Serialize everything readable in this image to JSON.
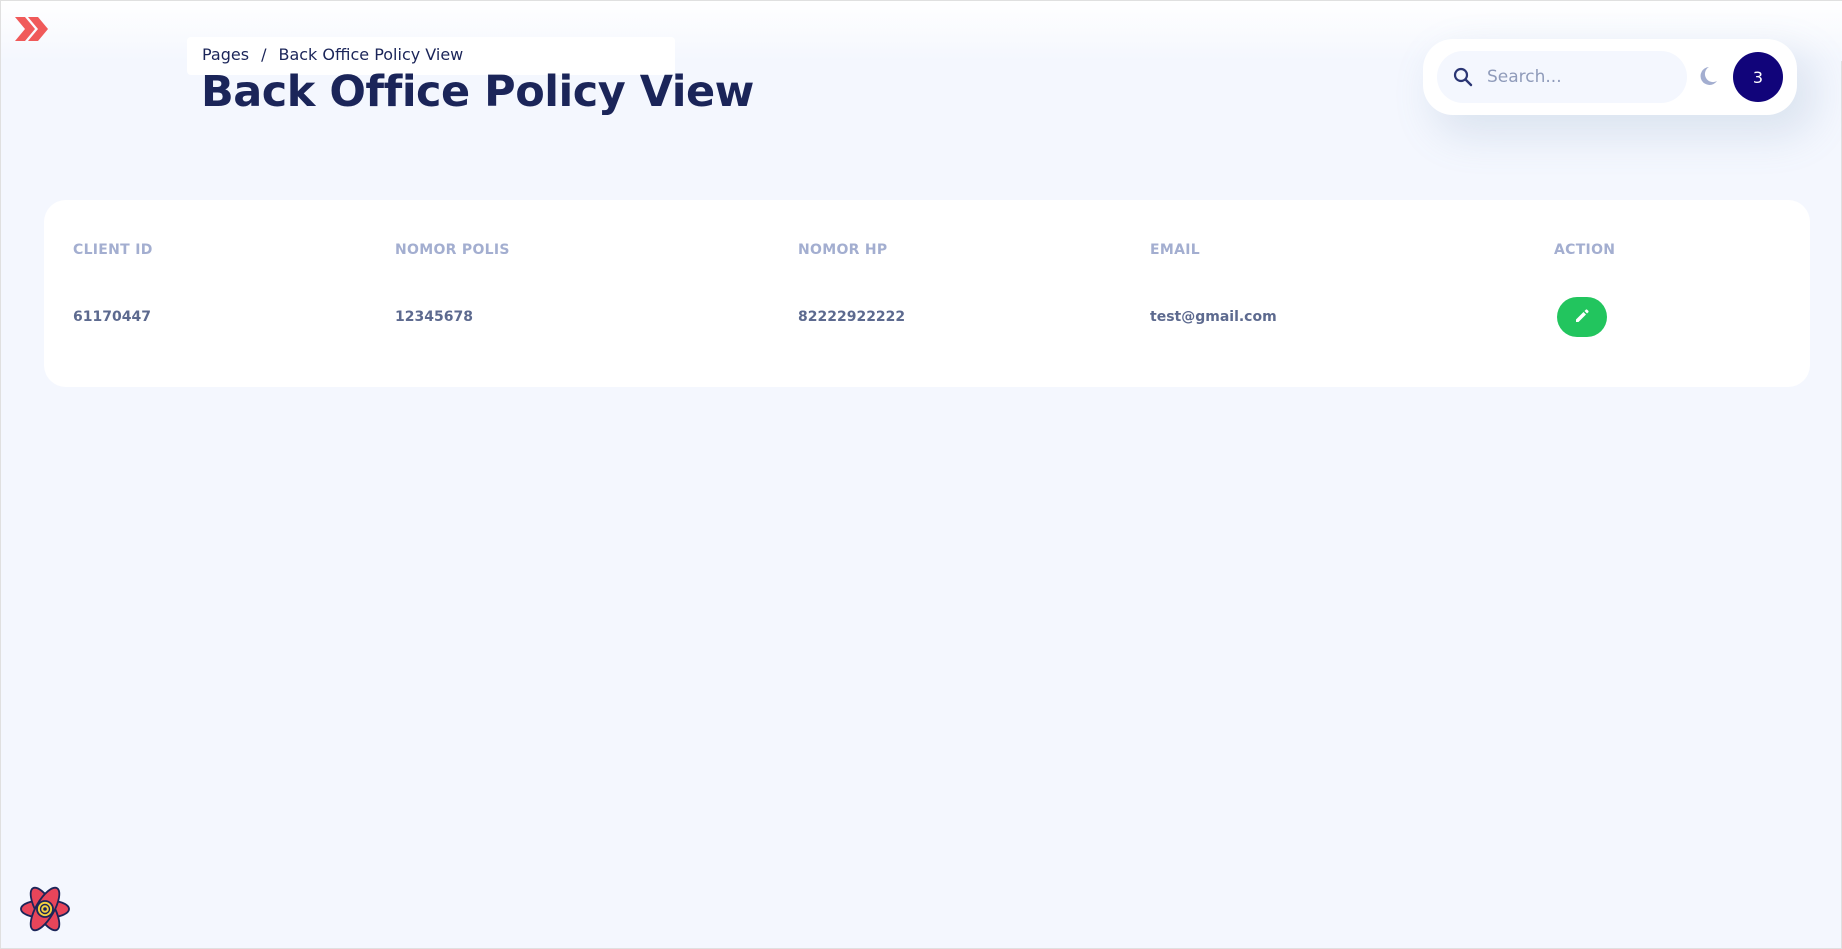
{
  "breadcrumb": {
    "root": "Pages",
    "separator": "/",
    "current": "Back Office Policy View"
  },
  "page_title": "Back Office Policy View",
  "search": {
    "placeholder": "Search..."
  },
  "avatar_label": "3",
  "table": {
    "headers": [
      "CLIENT ID",
      "NOMOR POLIS",
      "NOMOR HP",
      "EMAIL",
      "ACTION"
    ],
    "rows": [
      {
        "client_id": "61170447",
        "nomor_polis": "12345678",
        "nomor_hp": "82222922222",
        "email": "test@gmail.com",
        "action_icon": "pencil-icon"
      }
    ]
  },
  "colors": {
    "brand_red": "#f05a5a",
    "title": "#1b2559",
    "avatar_bg": "#11047a",
    "action_green": "#22c55e",
    "page_bg": "#f4f7fe"
  },
  "icons": [
    "double-chevron-right-icon",
    "search-icon",
    "moon-icon",
    "pencil-icon",
    "react-atom-icon"
  ]
}
